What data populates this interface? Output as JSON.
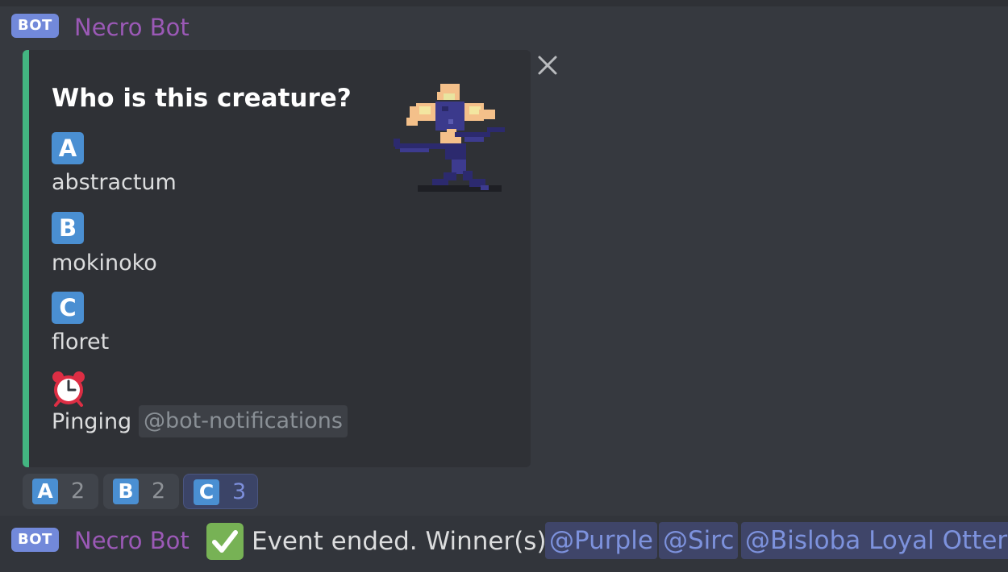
{
  "message1": {
    "badge": "BOT",
    "author": "Necro Bot",
    "embed": {
      "title": "Who is this creature?",
      "options": [
        {
          "letter": "A",
          "text": "abstractum"
        },
        {
          "letter": "B",
          "text": "mokinoko"
        },
        {
          "letter": "C",
          "text": "floret"
        }
      ],
      "ping_text": "Pinging",
      "role_mention": "@bot-notifications",
      "accent_color": "#43b581"
    },
    "reactions": [
      {
        "letter": "A",
        "count": "2"
      },
      {
        "letter": "B",
        "count": "2"
      },
      {
        "letter": "C",
        "count": "3"
      }
    ]
  },
  "message2": {
    "badge": "BOT",
    "author": "Necro Bot",
    "text": "Event ended. Winner(s):",
    "mentions": [
      "@Purple",
      "@Sirc",
      "@Bisloba Loyal Otter"
    ]
  },
  "icons": {
    "close": "close-icon",
    "clock": "alarm-clock-icon",
    "check": "check-mark-icon"
  }
}
